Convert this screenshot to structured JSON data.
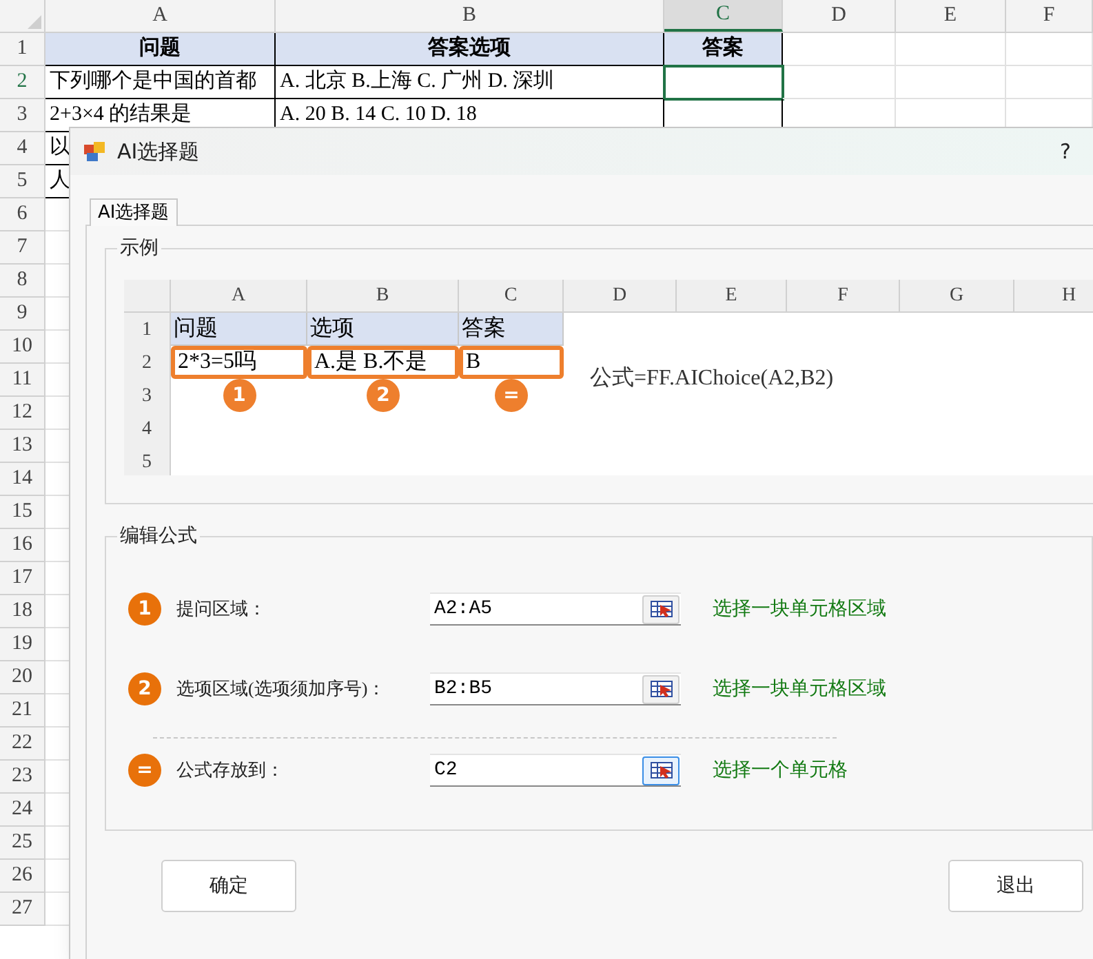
{
  "sheet": {
    "columns": [
      {
        "label": "A",
        "selected": false
      },
      {
        "label": "B",
        "selected": false
      },
      {
        "label": "C",
        "selected": true
      },
      {
        "label": "D",
        "selected": false
      },
      {
        "label": "E",
        "selected": false
      },
      {
        "label": "F",
        "selected": false
      }
    ],
    "rows": [
      {
        "number": "1",
        "kind": "header",
        "selected": false,
        "cells": [
          "问题",
          "答案选项",
          "答案"
        ]
      },
      {
        "number": "2",
        "kind": "plain",
        "selected": true,
        "cells": [
          "下列哪个是中国的首都",
          "A. 北京 B.上海  C. 广州 D. 深圳",
          ""
        ]
      },
      {
        "number": "3",
        "kind": "plain",
        "selected": false,
        "cells": [
          "2+3×4 的结果是",
          "A. 20 B. 14 C. 10 D. 18",
          ""
        ]
      },
      {
        "number": "4",
        "kind": "plain",
        "selected": false,
        "cells": [
          "以"
        ]
      },
      {
        "number": "5",
        "kind": "plain",
        "selected": false,
        "cells": [
          "人"
        ]
      },
      {
        "number": "6",
        "kind": "plain",
        "selected": false,
        "cells": []
      },
      {
        "number": "7",
        "kind": "plain",
        "selected": false,
        "cells": []
      },
      {
        "number": "8",
        "kind": "plain",
        "selected": false,
        "cells": []
      },
      {
        "number": "9",
        "kind": "plain",
        "selected": false,
        "cells": []
      },
      {
        "number": "10",
        "kind": "plain",
        "selected": false,
        "cells": []
      },
      {
        "number": "11",
        "kind": "plain",
        "selected": false,
        "cells": []
      },
      {
        "number": "12",
        "kind": "plain",
        "selected": false,
        "cells": []
      },
      {
        "number": "13",
        "kind": "plain",
        "selected": false,
        "cells": []
      },
      {
        "number": "14",
        "kind": "plain",
        "selected": false,
        "cells": []
      },
      {
        "number": "15",
        "kind": "plain",
        "selected": false,
        "cells": []
      },
      {
        "number": "16",
        "kind": "plain",
        "selected": false,
        "cells": []
      },
      {
        "number": "17",
        "kind": "plain",
        "selected": false,
        "cells": []
      },
      {
        "number": "18",
        "kind": "plain",
        "selected": false,
        "cells": []
      },
      {
        "number": "19",
        "kind": "plain",
        "selected": false,
        "cells": []
      },
      {
        "number": "20",
        "kind": "plain",
        "selected": false,
        "cells": []
      },
      {
        "number": "21",
        "kind": "plain",
        "selected": false,
        "cells": []
      },
      {
        "number": "22",
        "kind": "plain",
        "selected": false,
        "cells": []
      },
      {
        "number": "23",
        "kind": "plain",
        "selected": false,
        "cells": []
      },
      {
        "number": "24",
        "kind": "plain",
        "selected": false,
        "cells": []
      },
      {
        "number": "25",
        "kind": "plain",
        "selected": false,
        "cells": []
      },
      {
        "number": "26",
        "kind": "plain",
        "selected": false,
        "cells": []
      },
      {
        "number": "27",
        "kind": "plain",
        "selected": false,
        "cells": []
      }
    ]
  },
  "dialog": {
    "title": "AI选择题",
    "help": "?",
    "tabs": [
      {
        "label": "AI选择题",
        "selected": true
      }
    ],
    "example": {
      "legend": "示例",
      "columns": [
        "A",
        "B",
        "C",
        "D",
        "E",
        "F",
        "G",
        "H"
      ],
      "rows": [
        {
          "number": "1",
          "kind": "header",
          "cells": [
            "问题",
            "选项",
            "答案"
          ]
        },
        {
          "number": "2",
          "kind": "outlined",
          "cells": [
            "2*3=5吗",
            "A.是 B.不是",
            "B"
          ]
        },
        {
          "number": "3",
          "kind": "markers",
          "cells": [
            "1",
            "2",
            "="
          ]
        },
        {
          "number": "4",
          "kind": "plain",
          "cells": []
        },
        {
          "number": "5",
          "kind": "plain",
          "cells": []
        }
      ],
      "formula": "公式=FF.AIChoice(A2,B2)"
    },
    "edit": {
      "legend": "编辑公式",
      "fields": [
        {
          "badge": "1",
          "label": "提问区域：",
          "value": "A2:A5",
          "hint": "选择一块单元格区域",
          "focused": false,
          "separator_before": false
        },
        {
          "badge": "2",
          "label": "选项区域(选项须加序号)：",
          "value": "B2:B5",
          "hint": "选择一块单元格区域",
          "focused": false,
          "separator_before": false
        },
        {
          "badge": "=",
          "label": "公式存放到：",
          "value": "C2",
          "hint": "选择一个单元格",
          "focused": true,
          "separator_before": true
        }
      ]
    },
    "buttons": [
      "确定",
      "退出"
    ]
  }
}
